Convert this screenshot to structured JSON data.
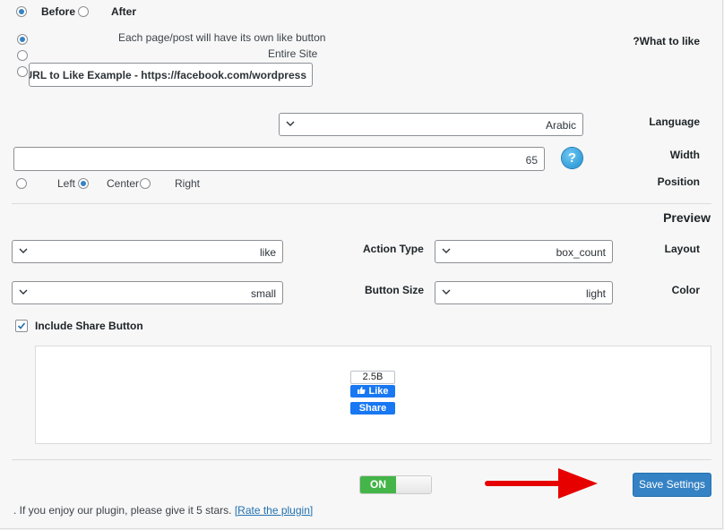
{
  "placement": {
    "before_label": "Before",
    "after_label": "After"
  },
  "what_to_like": {
    "label": "?What to like",
    "option_each": "Each page/post will have its own like button",
    "option_entire": "Entire Site",
    "url_value": "URL to Like Example - https://facebook.com/wordpress"
  },
  "language": {
    "label": "Language",
    "value": "Arabic"
  },
  "width": {
    "label": "Width",
    "value": "65",
    "help_glyph": "?"
  },
  "position": {
    "label": "Position",
    "left": "Left",
    "center": "Center",
    "right": "Right"
  },
  "preview": {
    "heading": "Preview"
  },
  "action_type": {
    "label": "Action Type",
    "value": "like"
  },
  "layout": {
    "label": "Layout",
    "value": "box_count"
  },
  "button_size": {
    "label": "Button Size",
    "value": "small"
  },
  "color": {
    "label": "Color",
    "value": "light"
  },
  "share": {
    "label": "Include Share Button",
    "checked": true
  },
  "fb_widget": {
    "count": "2.5B",
    "like": "Like",
    "share": "Share"
  },
  "toggle": {
    "label": "ON"
  },
  "save_button": {
    "label": "Save Settings"
  },
  "footer": {
    "text": ". If you enjoy our plugin, please give it 5 stars.",
    "link_text": "[Rate the plugin]"
  },
  "colors": {
    "accent": "#3582c4",
    "facebook": "#1877f2",
    "toggle_on": "#44b549",
    "arrow": "#e60000"
  }
}
